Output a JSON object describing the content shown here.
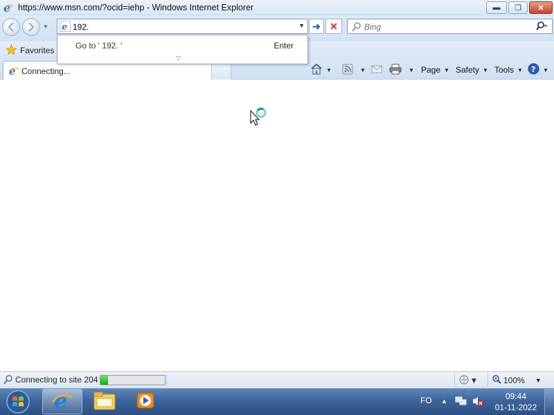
{
  "window": {
    "title": "https://www.msn.com/?ocid=iehp - Windows Internet Explorer",
    "minimize_label": "▬",
    "maximize_label": "❐",
    "close_label": "✕"
  },
  "address_bar": {
    "value": "192.",
    "suggestion_goto": "Go to ' 192. '",
    "suggestion_key": "Enter"
  },
  "search": {
    "placeholder": "Bing"
  },
  "favorites": {
    "label": "Favorites"
  },
  "tab": {
    "title": "Connecting..."
  },
  "command_bar": {
    "page": "Page",
    "safety": "Safety",
    "tools": "Tools"
  },
  "status_bar": {
    "text": "Connecting to site 204",
    "progress": 0.12,
    "zoom": "100%"
  },
  "taskbar": {
    "language": "FO",
    "time": "09:44",
    "date": "01-11-2022"
  },
  "colors": {
    "titlebar": "#dbe8f6",
    "taskbar": "#3d6499",
    "progress": "#13b013",
    "close_button": "#c6432b"
  },
  "icons": [
    "ie-icon",
    "back-icon",
    "forward-icon",
    "go-icon",
    "stop-icon",
    "search-icon",
    "star-icon",
    "home-icon",
    "feed-icon",
    "mail-icon",
    "print-icon",
    "help-icon",
    "busy-cursor-icon",
    "windows-orb-icon",
    "folder-icon",
    "media-player-icon",
    "network-icon",
    "volume-muted-icon",
    "zoom-icon",
    "protected-mode-icon"
  ]
}
